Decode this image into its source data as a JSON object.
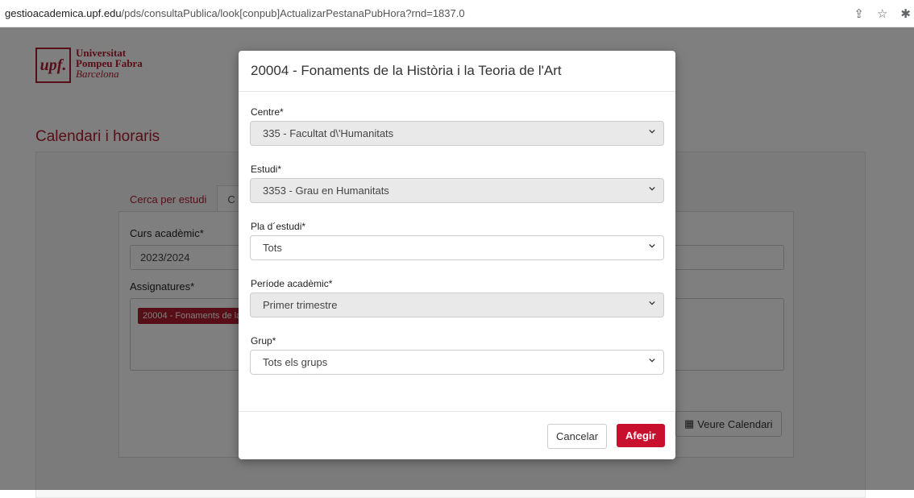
{
  "browser": {
    "url_host": "gestioacademica.upf.edu",
    "url_path": "/pds/consultaPublica/look[conpub]ActualizarPestanaPubHora?rnd=1837.0",
    "icons": [
      "share-icon",
      "star-icon",
      "extension-icon"
    ]
  },
  "logo": {
    "mark": "upf.",
    "line1": "Universitat",
    "line2": "Pompeu Fabra",
    "line3": "Barcelona"
  },
  "page": {
    "title": "Calendari i horaris",
    "tabs": [
      "Cerca per estudi",
      "C"
    ],
    "fields": {
      "curs_label": "Curs acadèmic*",
      "curs_value": "2023/2024",
      "assig_label": "Assignatures*",
      "assig_tag": "20004 - Fonaments de la"
    },
    "calendar_button": "Veure Calendari"
  },
  "modal": {
    "title": "20004 - Fonaments de la Història i la Teoria de l'Art",
    "fields": [
      {
        "label": "Centre*",
        "value": "335 - Facultat d\\'Humanitats",
        "disabled": true
      },
      {
        "label": "Estudi*",
        "value": "3353 - Grau en Humanitats",
        "disabled": true
      },
      {
        "label": "Pla d´estudi*",
        "value": "Tots",
        "disabled": false
      },
      {
        "label": "Període acadèmic*",
        "value": "Primer trimestre",
        "disabled": true
      },
      {
        "label": "Grup*",
        "value": "Tots els grups",
        "disabled": false
      }
    ],
    "cancel_label": "Cancelar",
    "add_label": "Afegir"
  },
  "colors": {
    "brand": "#b01c2e",
    "primary_button": "#c8102e"
  }
}
